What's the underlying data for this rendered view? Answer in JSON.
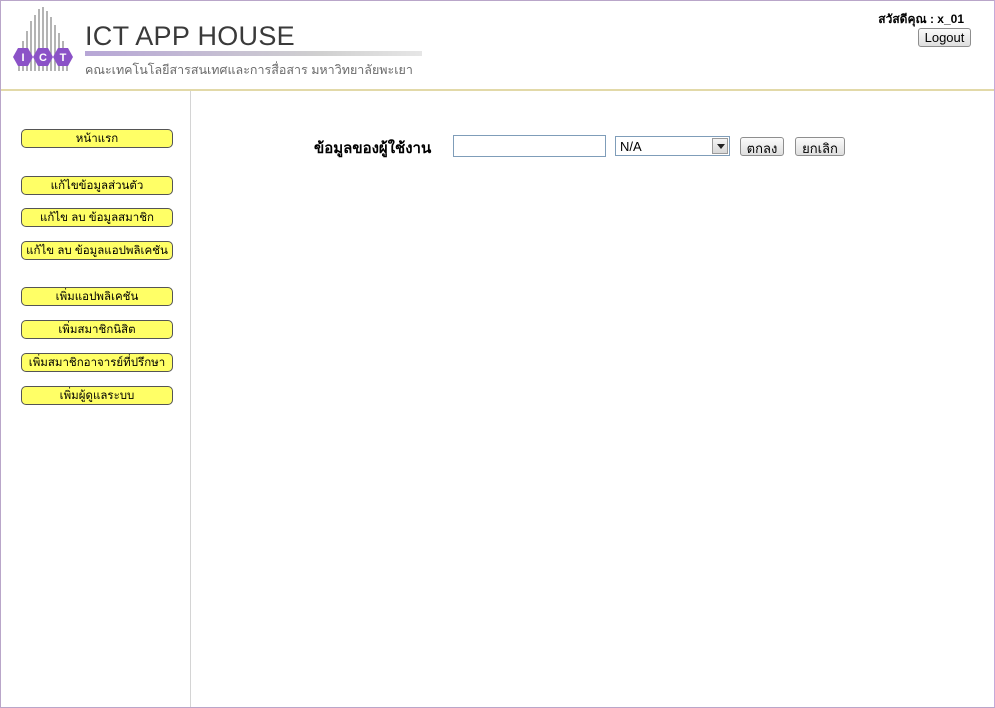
{
  "header": {
    "logo_letters": "ICT",
    "title": "ICT APP HOUSE",
    "subtitle": "คณะเทคโนโลยีสารสนเทศและการสื่อสาร มหาวิทยาลัยพะเยา",
    "greeting": "สวัสดีคุณ : x_01",
    "logout_label": "Logout"
  },
  "sidebar": {
    "items": [
      {
        "label": "หน้าแรก"
      },
      {
        "label": "แก้ไขข้อมูลส่วนตัว"
      },
      {
        "label": "แก้ไข ลบ ข้อมูลสมาชิก"
      },
      {
        "label": "แก้ไข ลบ ข้อมูลแอปพลิเคชัน"
      },
      {
        "label": "เพิ่มแอปพลิเคชัน"
      },
      {
        "label": "เพิ่มสมาชิกนิสิต"
      },
      {
        "label": "เพิ่มสมาชิกอาจารย์ที่ปรึกษา"
      },
      {
        "label": "เพิ่มผู้ดูแลระบบ"
      }
    ]
  },
  "search": {
    "label": "ข้อมูลของผู้ใช้งาน",
    "input_value": "",
    "select_value": "N/A",
    "submit_label": "ตกลง",
    "cancel_label": "ยกเลิก"
  },
  "colors": {
    "nav_button_bg": "#ffff66",
    "logo_purple": "#8b52c7",
    "frame_border": "#b9a6c9"
  }
}
